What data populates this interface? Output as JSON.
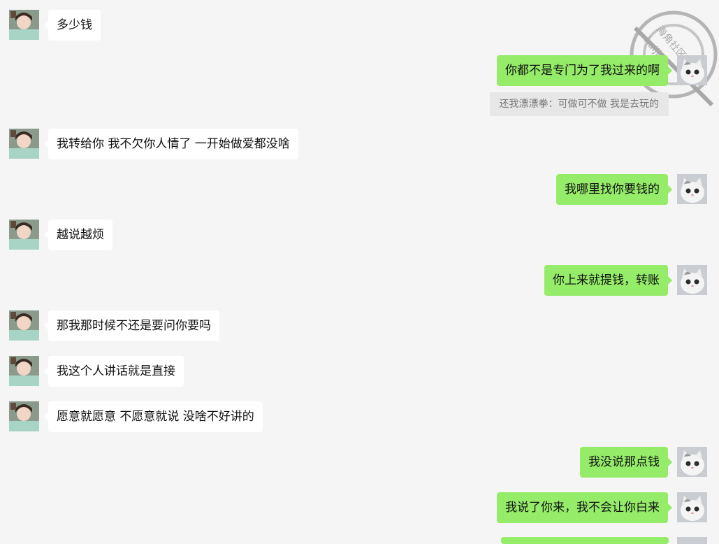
{
  "messages": [
    {
      "side": "left",
      "text": "多少钱"
    },
    {
      "side": "right",
      "text": "你都不是专门为了我过来的啊"
    },
    {
      "side": "left",
      "text": "我转给你 我不欠你人情了 一开始做爱都没啥"
    },
    {
      "side": "right",
      "text": "我哪里找你要钱的"
    },
    {
      "side": "left",
      "text": "越说越烦"
    },
    {
      "side": "right",
      "text": "你上来就提钱，转账"
    },
    {
      "side": "left",
      "text": "那我那时候不还是要问你要吗"
    },
    {
      "side": "left",
      "text": "我这个人讲话就是直接"
    },
    {
      "side": "left",
      "text": "愿意就愿意 不愿意就说 没啥不好讲的"
    },
    {
      "side": "right",
      "text": "我没说那点钱"
    },
    {
      "side": "right",
      "text": "我说了你来，我不会让你白来"
    }
  ],
  "quote": {
    "text": "还我漂漂拳：可做可不做 我是去玩的"
  },
  "watermark": {
    "line1": "海角社区",
    "line2": "haijiao"
  },
  "colors": {
    "sent_bubble": "#95ec69",
    "received_bubble": "#ffffff",
    "background": "#f5f5f5"
  }
}
